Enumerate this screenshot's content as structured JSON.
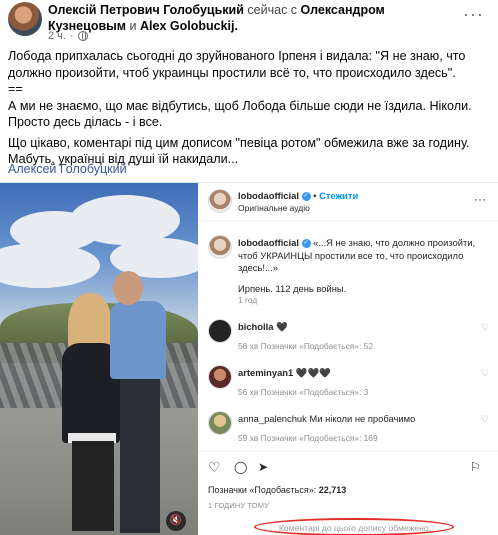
{
  "post": {
    "author": "Олексій Петрович Голобуцький",
    "with_text": "сейчас с",
    "tagged_1": "Олександром Кузнецовым",
    "and_text": "и",
    "tagged_2": "Alex Golobuckij.",
    "time": "2 ч.",
    "dot": "·",
    "paragraph_1": "Лобода припхалась сьогодні до зруйнованого Ірпеня і видала: \"Я не знаю, что должно произойти, чтоб украинцы простили всё то, что происходило здесь\".",
    "separator": "==",
    "paragraph_2": "А ми не знаємо, що має відбутись, щоб Лобода більше сюди не їздила. Ніколи. Просто десь ділась - і все.",
    "paragraph_3": "Що цікаво, коментарі під цим дописом \"певіца ротом\" обмежила вже за годину. Мабуть, українці від душі їй накидали...",
    "author_link": "Алексей Голобуцкий",
    "icons": {
      "more": "more-options-icon",
      "privacy": "globe-icon"
    }
  },
  "instagram": {
    "header": {
      "username": "lobodaofficial",
      "dot": "•",
      "follow": "Стежити",
      "subtitle": "Оригінальне аудіо"
    },
    "caption": {
      "username": "lobodaofficial",
      "text": "«...Я не знаю, что должно произойти, чтоб УКРАИНЦЫ простили все то, что происходило здесь!...»",
      "line2": "Ирпень. 112 день войны.",
      "meta": "1 год"
    },
    "comments": [
      {
        "username": "bicholla",
        "text": "🖤",
        "meta": "58 хв    Позначки «Подобається»: 52"
      },
      {
        "username": "arteminyan1",
        "text": "🖤🖤🖤",
        "meta": "56 хв    Позначки «Подобається»: 3"
      },
      {
        "username": "anna_palenchuk",
        "text": "Ми ніколи не пробачимо",
        "meta": "59 хв    Позначки «Подобається»: 169"
      }
    ],
    "likes_label": "Позначки «Подобається»:",
    "likes_count": "22,713",
    "time_ago": "1 ГОДИНУ ТОМУ",
    "comments_off": "Коментарі до цього допису обмежено.",
    "highlight_color": "#e0302a"
  }
}
